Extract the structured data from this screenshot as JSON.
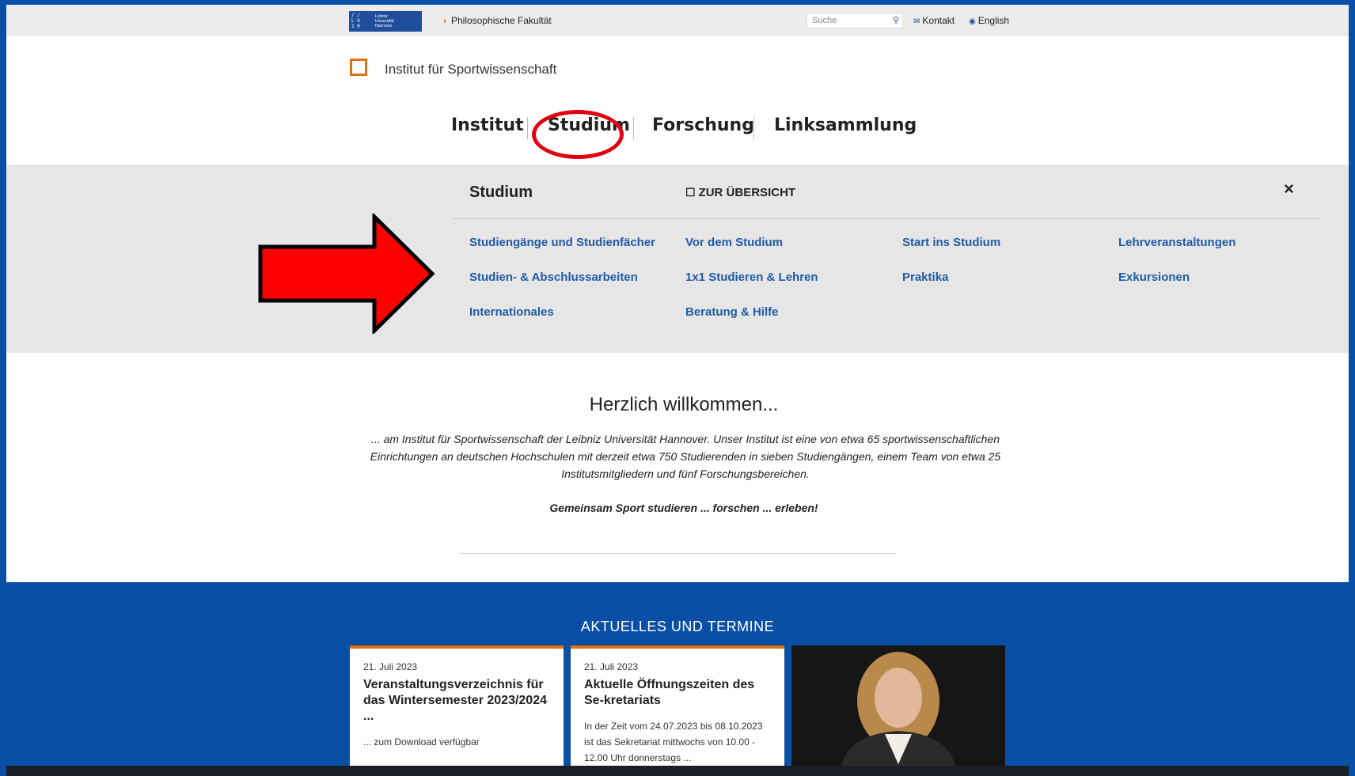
{
  "topbar": {
    "logo_lines": [
      "Leibniz",
      "Universität",
      "Hannover"
    ],
    "breadcrumb": "Philosophische Fakultät",
    "search_placeholder": "Suche",
    "kontakt": "Kontakt",
    "english": "English"
  },
  "institute": {
    "name": "Institut für Sportwissenschaft"
  },
  "nav": {
    "items": [
      "Institut",
      "Studium",
      "Forschung",
      "Linksammlung"
    ]
  },
  "mega": {
    "title": "Studium",
    "overview": "ZUR ÜBERSICHT",
    "close": "×",
    "links": [
      "Studiengänge und Studienfächer",
      "Vor dem Studium",
      "Start ins Studium",
      "Lehrveranstaltungen",
      "Studien- & Abschlussarbeiten",
      "1x1 Studieren & Lehren",
      "Praktika",
      "Exkursionen",
      "Internationales",
      "Beratung & Hilfe"
    ]
  },
  "welcome": {
    "title": "Herzlich willkommen...",
    "text": "... am Institut für Sportwissenschaft der Leibniz Universität Hannover. Unser Institut ist eine von etwa 65 sportwissenschaftlichen Einrichtungen an deutschen Hochschulen mit derzeit etwa 750 Studierenden in sieben Studiengängen, einem Team von etwa 25 Institutsmitgliedern und fünf Forschungsbereichen.",
    "slogan": "Gemeinsam Sport studieren ... forschen ... erleben!"
  },
  "news": {
    "title": "AKTUELLES UND TERMINE",
    "cards": [
      {
        "date": "21. Juli 2023",
        "headline": "Veranstaltungsverzeichnis für das Wintersemester 2023/2024 ...",
        "teaser": "... zum Download verfügbar"
      },
      {
        "date": "21. Juli 2023",
        "headline": "Aktuelle Öffnungszeiten des Se-kretariats",
        "teaser": "In der Zeit vom 24.07.2023 bis 08.10.2023 ist das Sekretariat mittwochs von 10.00 - 12.00 Uhr donnerstags ..."
      }
    ]
  },
  "colors": {
    "brand_blue": "#0a4fa6",
    "accent_orange": "#e07010",
    "highlight_red": "#e00010",
    "link_blue": "#1f5ca8"
  }
}
